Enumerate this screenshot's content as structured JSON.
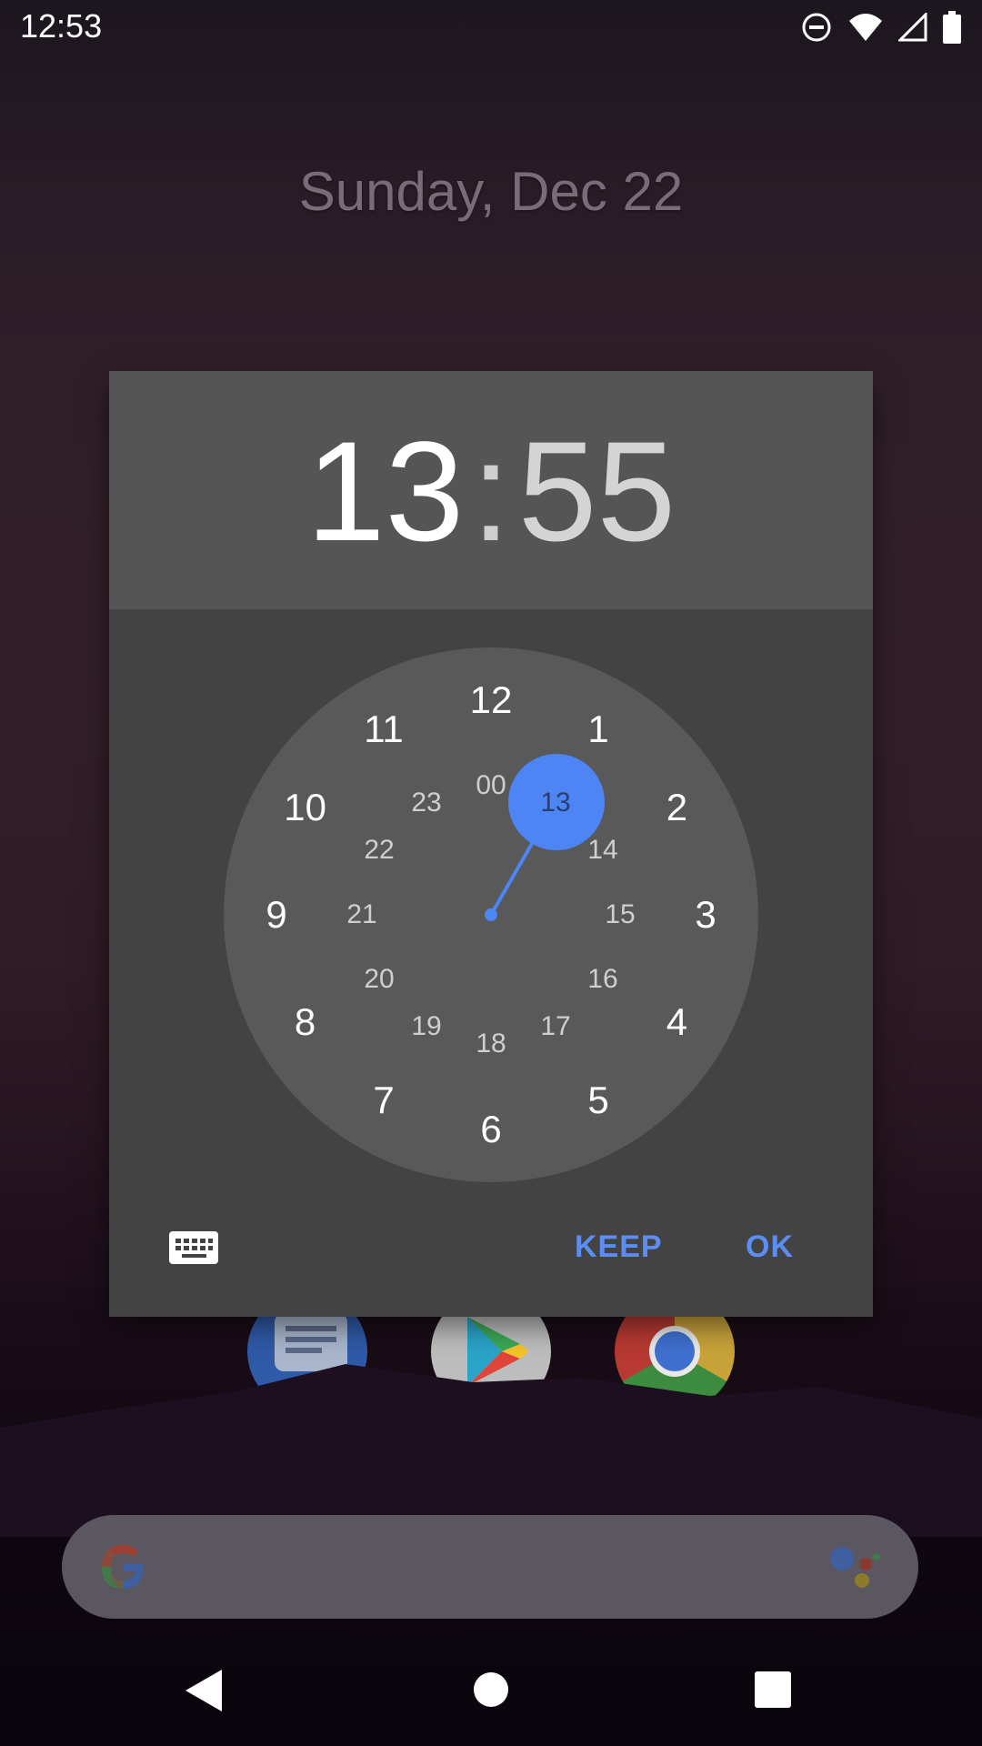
{
  "status_bar": {
    "time": "12:53"
  },
  "home": {
    "date": "Sunday, Dec 22"
  },
  "dialog": {
    "hour": "13",
    "separator": ":",
    "minute": "55",
    "outer_numbers": [
      "12",
      "1",
      "2",
      "3",
      "4",
      "5",
      "6",
      "7",
      "8",
      "9",
      "10",
      "11"
    ],
    "inner_numbers": [
      "00",
      "13",
      "14",
      "15",
      "16",
      "17",
      "18",
      "19",
      "20",
      "21",
      "22",
      "23"
    ],
    "selected": "13",
    "keep_label": "KEEP",
    "ok_label": "OK"
  },
  "colors": {
    "accent": "#4d85f5",
    "button_text": "#5c8ef2",
    "dialog_bg": "#434343",
    "header_bg": "#555555"
  },
  "icons": [
    "dnd-icon",
    "wifi-icon",
    "signal-icon",
    "battery-icon",
    "keyboard-icon",
    "messages-app-icon",
    "play-store-icon",
    "chrome-icon",
    "google-logo-icon",
    "assistant-icon",
    "back-icon",
    "home-icon",
    "recents-icon"
  ]
}
